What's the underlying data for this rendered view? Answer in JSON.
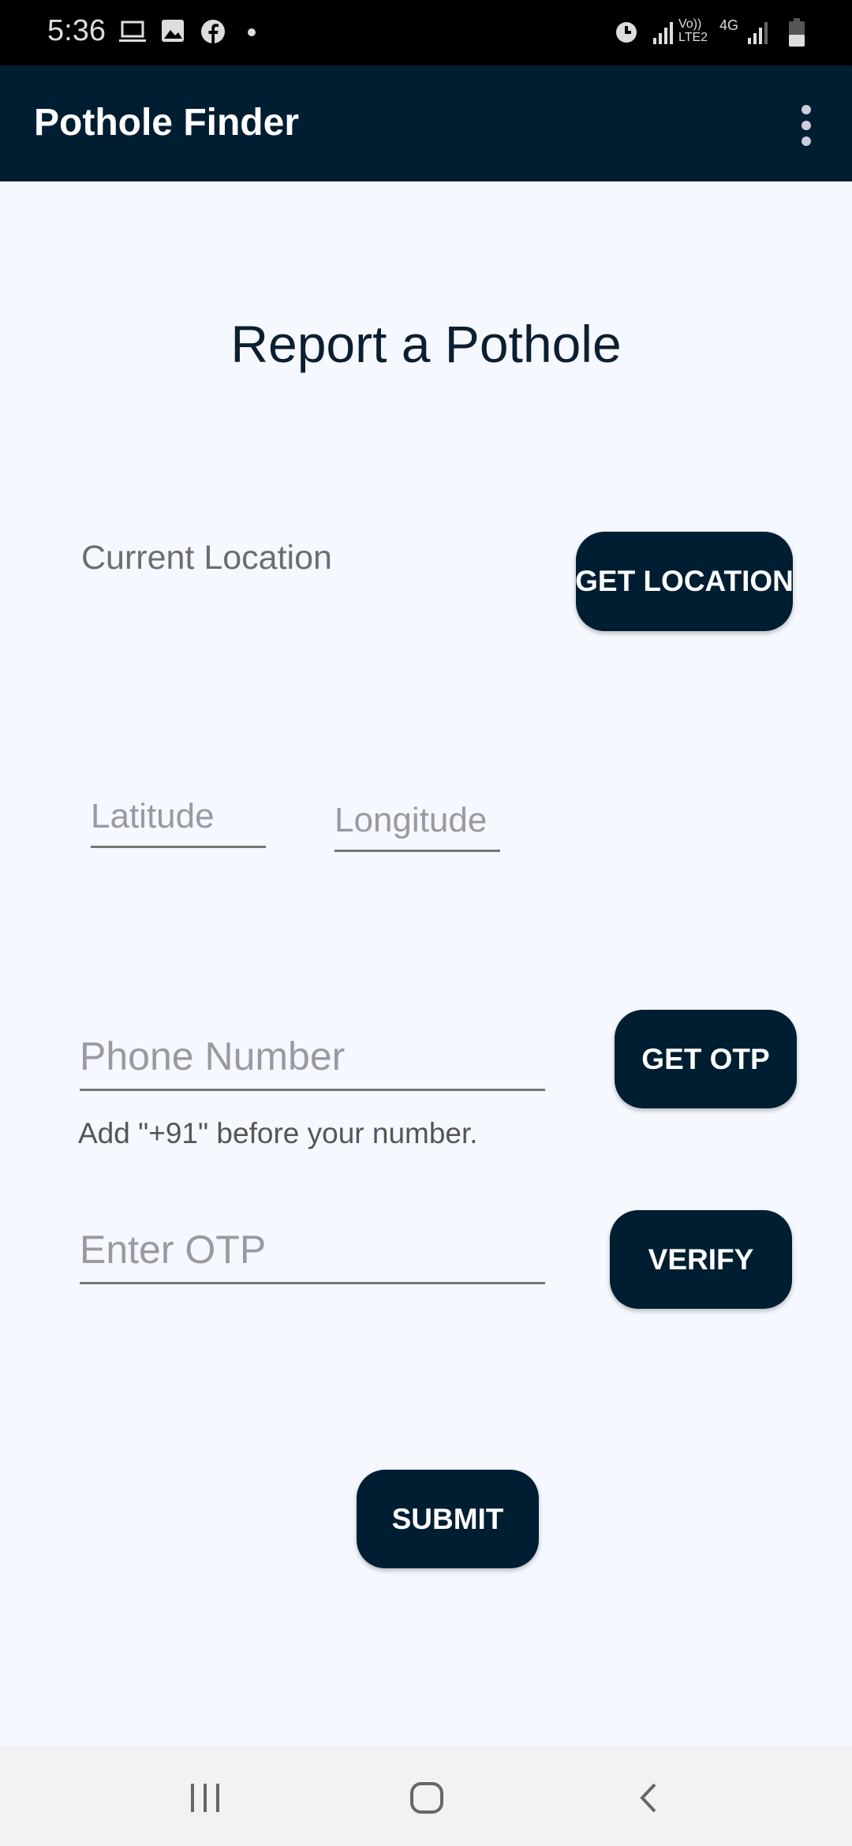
{
  "status_bar": {
    "time": "5:36",
    "network_label_1": "Vo)) LTE2",
    "network_label_2": "4G"
  },
  "app_bar": {
    "title": "Pothole Finder"
  },
  "main": {
    "heading": "Report a Pothole",
    "current_location_label": "Current Location",
    "get_location_button": "GET LOCATION",
    "latitude_placeholder": "Latitude",
    "longitude_placeholder": "Longitude",
    "phone_placeholder": "Phone Number",
    "phone_helper": "Add \"+91\" before your number.",
    "get_otp_button": "GET OTP",
    "otp_placeholder": "Enter OTP",
    "verify_button": "VERIFY",
    "submit_button": "SUBMIT"
  },
  "colors": {
    "primary": "#001e32",
    "background": "#f5f8fe"
  }
}
